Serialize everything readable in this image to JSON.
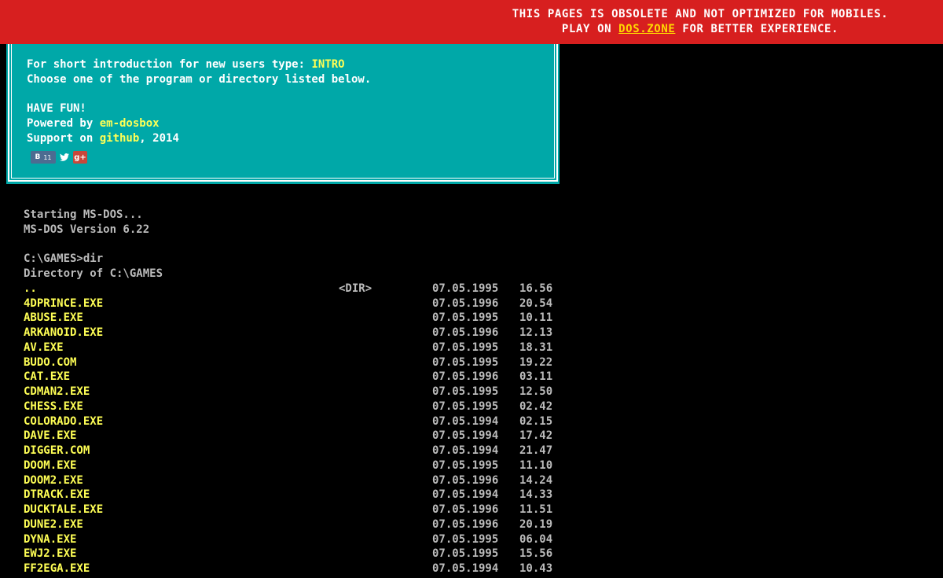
{
  "banner": {
    "line1": "THIS PAGES IS OBSOLETE AND NOT OPTIMIZED FOR MOBILES.",
    "line2_prefix": "PLAY ON ",
    "line2_link": "DOS.ZONE",
    "line2_suffix": " FOR BETTER EXPERIENCE.",
    "bg_color": "#d71f1f",
    "link_color": "#ffd800"
  },
  "info": {
    "intro_prefix": "For short introduction for new users type: ",
    "intro_cmd": "INTRO",
    "choose": "Choose one of the program or directory listed below.",
    "have_fun": "HAVE FUN!",
    "powered_prefix": "Powered by ",
    "powered_link": "em-dosbox",
    "support_prefix": "Support on ",
    "support_link": "github",
    "support_suffix": ", 2014",
    "bg_color": "#00a8a8",
    "social": {
      "vk_label": "В",
      "vk_count": "11",
      "twitter_icon": "twitter-bird-icon",
      "gplus_label": "g+"
    }
  },
  "terminal": {
    "starting": "Starting MS-DOS...",
    "version": "MS-DOS Version 6.22",
    "prompt": "C:\\GAMES>dir",
    "dir_header": "Directory of C:\\GAMES",
    "entries": [
      {
        "name": "..",
        "dir": "<DIR>",
        "date": "07.05.1995",
        "time": "16.56"
      },
      {
        "name": "4DPRINCE.EXE",
        "dir": "",
        "date": "07.05.1996",
        "time": "20.54"
      },
      {
        "name": "ABUSE.EXE",
        "dir": "",
        "date": "07.05.1995",
        "time": "10.11"
      },
      {
        "name": "ARKANOID.EXE",
        "dir": "",
        "date": "07.05.1996",
        "time": "12.13"
      },
      {
        "name": "AV.EXE",
        "dir": "",
        "date": "07.05.1995",
        "time": "18.31"
      },
      {
        "name": "BUDO.COM",
        "dir": "",
        "date": "07.05.1995",
        "time": "19.22"
      },
      {
        "name": "CAT.EXE",
        "dir": "",
        "date": "07.05.1996",
        "time": "03.11"
      },
      {
        "name": "CDMAN2.EXE",
        "dir": "",
        "date": "07.05.1995",
        "time": "12.50"
      },
      {
        "name": "CHESS.EXE",
        "dir": "",
        "date": "07.05.1995",
        "time": "02.42"
      },
      {
        "name": "COLORADO.EXE",
        "dir": "",
        "date": "07.05.1994",
        "time": "02.15"
      },
      {
        "name": "DAVE.EXE",
        "dir": "",
        "date": "07.05.1994",
        "time": "17.42"
      },
      {
        "name": "DIGGER.COM",
        "dir": "",
        "date": "07.05.1994",
        "time": "21.47"
      },
      {
        "name": "DOOM.EXE",
        "dir": "",
        "date": "07.05.1995",
        "time": "11.10"
      },
      {
        "name": "DOOM2.EXE",
        "dir": "",
        "date": "07.05.1996",
        "time": "14.24"
      },
      {
        "name": "DTRACK.EXE",
        "dir": "",
        "date": "07.05.1994",
        "time": "14.33"
      },
      {
        "name": "DUCKTALE.EXE",
        "dir": "",
        "date": "07.05.1996",
        "time": "11.51"
      },
      {
        "name": "DUNE2.EXE",
        "dir": "",
        "date": "07.05.1996",
        "time": "20.19"
      },
      {
        "name": "DYNA.EXE",
        "dir": "",
        "date": "07.05.1995",
        "time": "06.04"
      },
      {
        "name": "EWJ2.EXE",
        "dir": "",
        "date": "07.05.1995",
        "time": "15.56"
      },
      {
        "name": "FF2EGA.EXE",
        "dir": "",
        "date": "07.05.1994",
        "time": "10.43"
      }
    ]
  }
}
